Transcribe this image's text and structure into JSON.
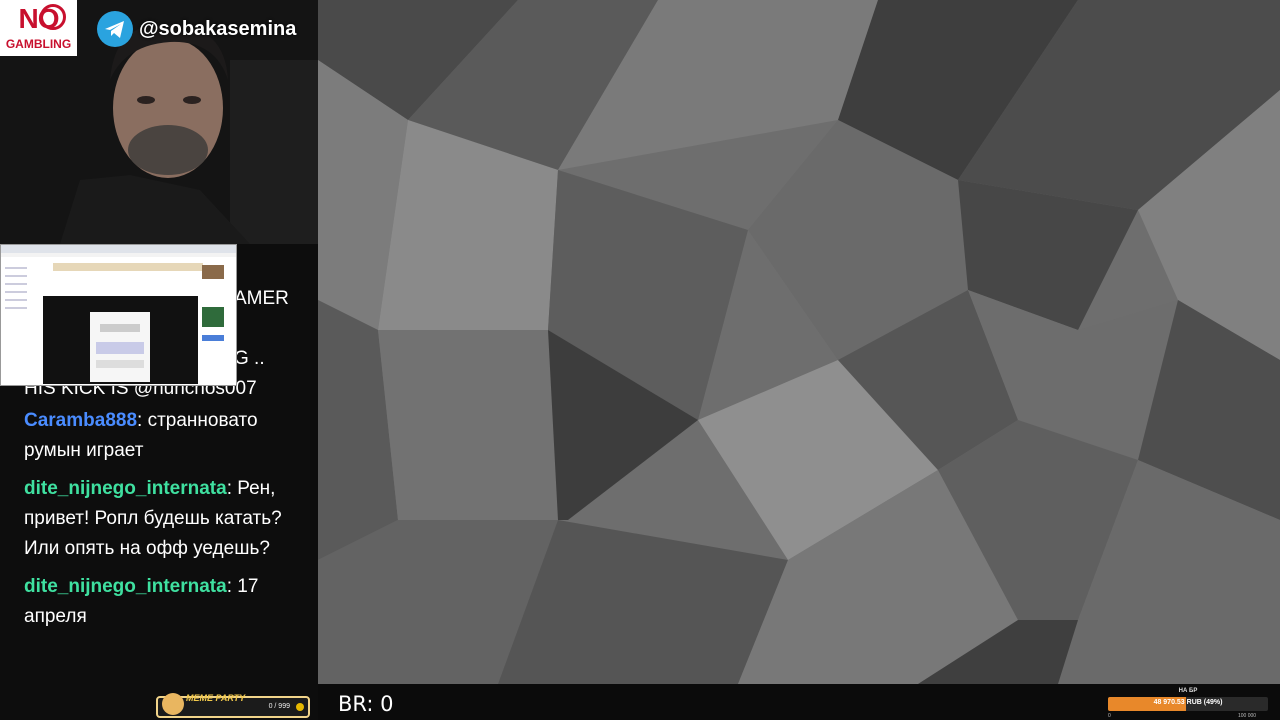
{
  "overlay": {
    "badge_no": "NO",
    "badge_gambling": "GAMBLING",
    "telegram_handle": "@sobakasemina"
  },
  "chat": {
    "partial_lines": [
      "AMER",
      "G ..",
      "HIS KICK IS @nunchos007"
    ],
    "messages": [
      {
        "user": "Caramba888",
        "text": "странновато румын играет"
      },
      {
        "user": "dite_nijnego_internata",
        "text": "Рен, привет! Ропл будешь катать? Или опять на офф уедешь?"
      },
      {
        "user": "dite_nijnego_internata",
        "text": "17 апреля"
      }
    ]
  },
  "bottom_bar": {
    "br_label": "BR: 0",
    "progress_title": "НА БР",
    "progress_text": "48 970.53 RUB (49%)",
    "progress_percent": 49,
    "min": "0",
    "max": "100 000"
  },
  "meme_party": {
    "label": "MEME PARTY",
    "count": "0 / 999"
  },
  "colors": {
    "username_blue": "#4a8cff",
    "username_green": "#3fe0a0",
    "progress_fill": "#e8882a",
    "telegram": "#2aa3df",
    "badge_red": "#c8102e"
  }
}
